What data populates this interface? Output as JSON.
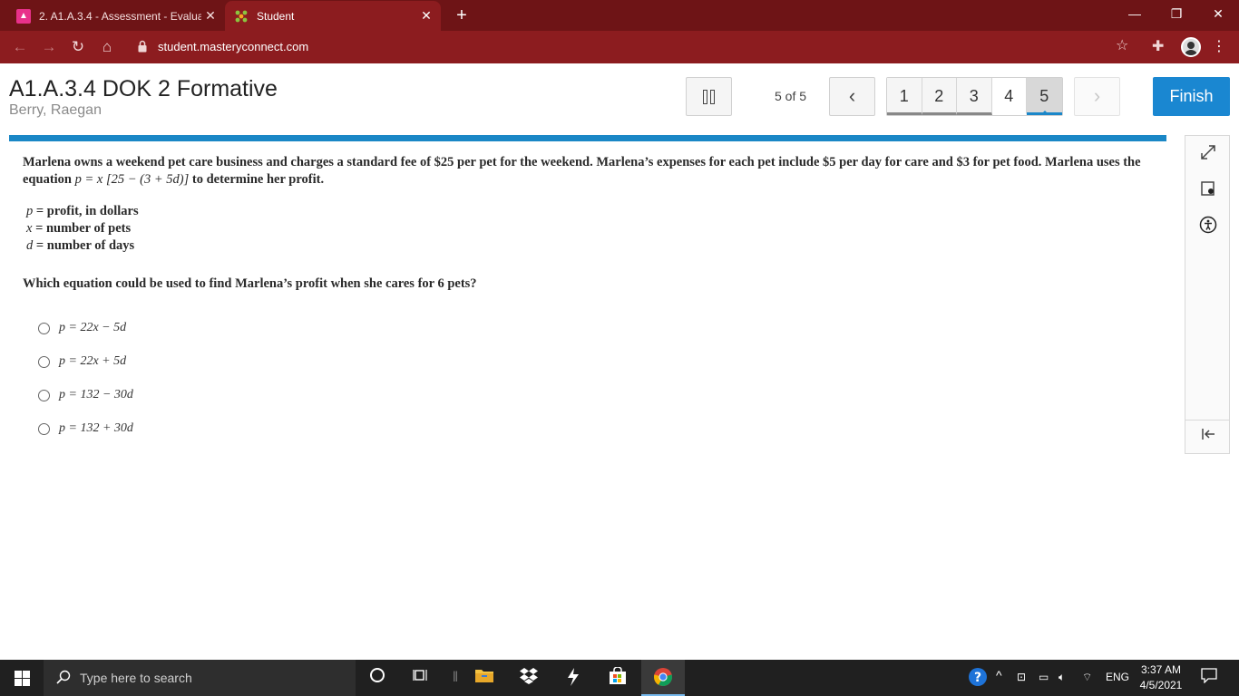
{
  "browser": {
    "tabs": [
      {
        "title": "2. A1.A.3.4 - Assessment - Evalua",
        "close": "✕"
      },
      {
        "title": "Student",
        "close": "✕"
      }
    ],
    "new_tab": "+",
    "window_controls": {
      "minimize": "—",
      "maximize": "❐",
      "close": "✕"
    },
    "url": "student.masteryconnect.com"
  },
  "assessment": {
    "title": "A1.A.3.4 DOK 2 Formative",
    "student": "Berry, Raegan",
    "position": "5 of 5",
    "questions": [
      "1",
      "2",
      "3",
      "4",
      "5"
    ],
    "current_question": "5",
    "finish_label": "Finish"
  },
  "question": {
    "stem_part1": "Marlena owns a weekend pet care business and charges a standard fee of $25 per pet for the weekend. Marlena’s expenses for each pet include $5 per day for care and $3 for pet food. Marlena uses the equation ",
    "stem_equation": "p = x [25 − (3 + 5d)]",
    "stem_part2": " to determine her profit.",
    "definitions": [
      {
        "var": "p",
        "text": " = profit, in dollars"
      },
      {
        "var": "x",
        "text": " = number of pets"
      },
      {
        "var": "d",
        "text": " = number of days"
      }
    ],
    "prompt": "Which equation could be used to find Marlena’s profit when she cares for 6 pets?",
    "choices": [
      "p = 22x − 5d",
      "p = 22x + 5d",
      "p = 132 − 30d",
      "p = 132 + 30d"
    ]
  },
  "taskbar": {
    "search_placeholder": "Type here to search",
    "language": "ENG",
    "time": "3:37 AM",
    "date": "4/5/2021"
  },
  "colors": {
    "browser_frame": "#6e1416",
    "toolbar": "#8c1c1f",
    "accent": "#1a87d1"
  }
}
